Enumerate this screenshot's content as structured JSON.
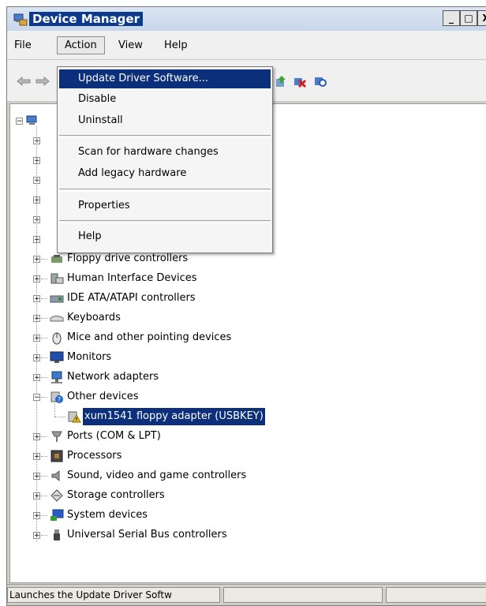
{
  "window": {
    "title": "Device Manager",
    "minimize_label": "_",
    "restore_label": "□",
    "close_label": "X"
  },
  "menubar": {
    "items": [
      "File",
      "Action",
      "View",
      "Help"
    ]
  },
  "action_menu": {
    "items": [
      {
        "label": "Update Driver Software...",
        "highlighted": true
      },
      {
        "label": "Disable"
      },
      {
        "label": "Uninstall"
      },
      {
        "separator": true
      },
      {
        "label": "Scan for hardware changes"
      },
      {
        "label": "Add legacy hardware"
      },
      {
        "separator": true
      },
      {
        "label": "Properties"
      },
      {
        "separator": true
      },
      {
        "label": "Help"
      }
    ]
  },
  "tree": {
    "items": [
      {
        "label": "Floppy drive controllers",
        "icon": "floppy-controller-icon"
      },
      {
        "label": "Human Interface Devices",
        "icon": "hid-icon"
      },
      {
        "label": "IDE ATA/ATAPI controllers",
        "icon": "ide-controller-icon"
      },
      {
        "label": "Keyboards",
        "icon": "keyboard-icon"
      },
      {
        "label": "Mice and other pointing devices",
        "icon": "mouse-icon"
      },
      {
        "label": "Monitors",
        "icon": "monitor-icon"
      },
      {
        "label": "Network adapters",
        "icon": "network-adapter-icon"
      },
      {
        "label": "Other devices",
        "icon": "unknown-device-icon",
        "expanded": true
      },
      {
        "label": "xum1541 floppy adapter (USBKEY)",
        "icon": "warning-device-icon",
        "child": true,
        "selected": true
      },
      {
        "label": "Ports (COM & LPT)",
        "icon": "port-icon"
      },
      {
        "label": "Processors",
        "icon": "processor-icon"
      },
      {
        "label": "Sound, video and game controllers",
        "icon": "sound-icon"
      },
      {
        "label": "Storage controllers",
        "icon": "storage-icon"
      },
      {
        "label": "System devices",
        "icon": "system-device-icon"
      },
      {
        "label": "Universal Serial Bus controllers",
        "icon": "usb-icon"
      }
    ]
  },
  "statusbar": {
    "text": "Launches the Update Driver Softw"
  },
  "colors": {
    "selection": "#0b2f7a",
    "title_bar": "#0b3a8c"
  }
}
